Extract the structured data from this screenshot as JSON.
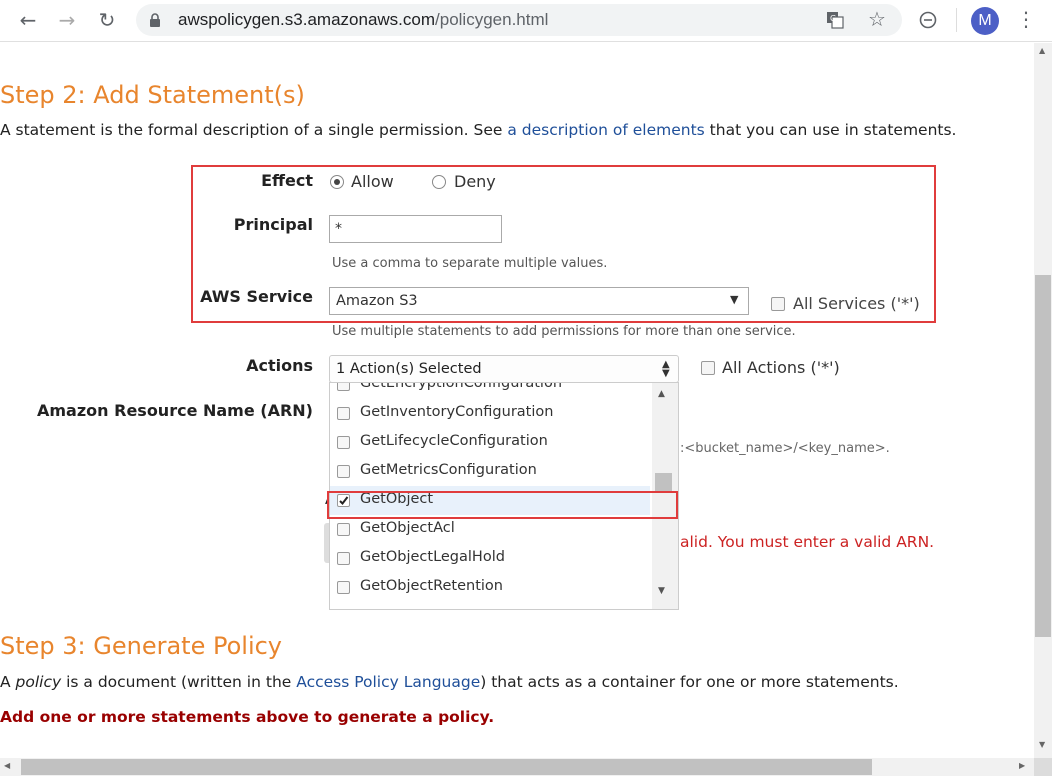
{
  "browser": {
    "url_host": "awspolicygen.s3.amazonaws.com",
    "url_path": "/policygen.html",
    "profile_initial": "M"
  },
  "step2": {
    "title": "Step 2: Add Statement(s)",
    "desc_before": "A statement is the formal description of a single permission. See ",
    "desc_link": "a description of elements",
    "desc_after": " that you can use in statements."
  },
  "form": {
    "effect_label": "Effect",
    "effect_allow": "Allow",
    "effect_deny": "Deny",
    "principal_label": "Principal",
    "principal_value": "*",
    "principal_hint": "Use a comma to separate multiple values.",
    "service_label": "AWS Service",
    "service_value": "Amazon S3",
    "all_services": "All Services ('*')",
    "service_hint": "Use multiple statements to add permissions for more than one service.",
    "actions_label": "Actions",
    "actions_value": "1 Action(s) Selected",
    "all_actions": "All Actions ('*')",
    "arn_label": "Amazon Resource Name (ARN)",
    "arn_hint_fragment": ":<bucket_name>/<key_name>.",
    "arn_error_fragment": "alid. You must enter a valid ARN."
  },
  "actions_list": {
    "items": [
      {
        "label": "GetEncryptionConfiguration",
        "checked": false
      },
      {
        "label": "GetInventoryConfiguration",
        "checked": false
      },
      {
        "label": "GetLifecycleConfiguration",
        "checked": false
      },
      {
        "label": "GetMetricsConfiguration",
        "checked": false
      },
      {
        "label": "GetObject",
        "checked": true
      },
      {
        "label": "GetObjectAcl",
        "checked": false
      },
      {
        "label": "GetObjectLegalHold",
        "checked": false
      },
      {
        "label": "GetObjectRetention",
        "checked": false
      }
    ]
  },
  "step3": {
    "title": "Step 3: Generate Policy",
    "desc_a": "A ",
    "desc_policy": "policy",
    "desc_b": " is a document (written in the ",
    "desc_link": "Access Policy Language",
    "desc_c": ") that acts as a container for one or more statements.",
    "warning": "Add one or more statements above to generate a policy."
  },
  "colors": {
    "heading": "#e8852d",
    "link": "#1f4f99",
    "error": "#cc2222",
    "warning": "#990000",
    "highlight_box": "#e03c3c"
  }
}
